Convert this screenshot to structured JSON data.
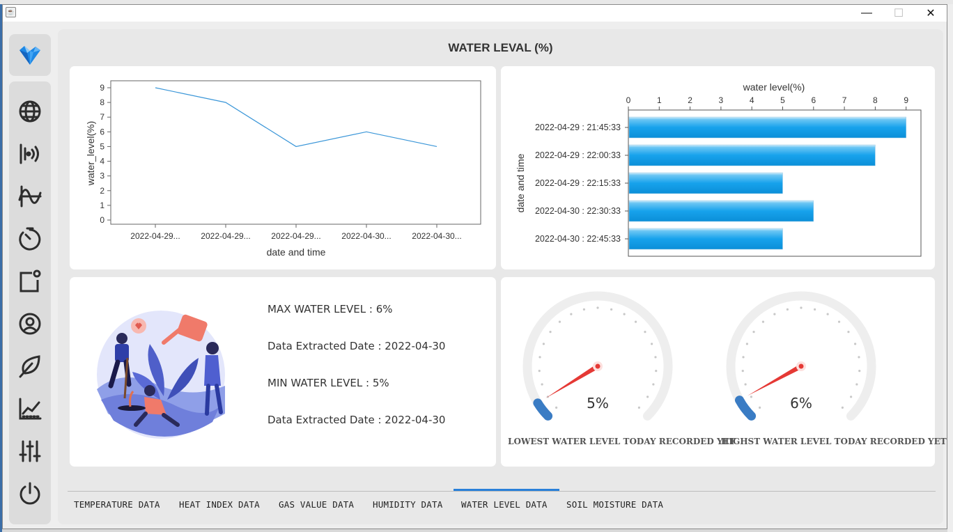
{
  "window": {
    "minimize": "—",
    "maximize": "☐",
    "close": "✕"
  },
  "page_title": "WATER LEVAL (%)",
  "sidebar": {
    "logo_icon": "iceberg-logo-icon",
    "items": [
      {
        "icon": "globe-icon"
      },
      {
        "icon": "wireless-signal-icon"
      },
      {
        "icon": "wave-graph-icon"
      },
      {
        "icon": "timer-icon"
      },
      {
        "icon": "notification-square-icon"
      },
      {
        "icon": "user-refresh-icon"
      },
      {
        "icon": "leaf-icon"
      },
      {
        "icon": "line-chart-icon"
      },
      {
        "icon": "sliders-icon"
      },
      {
        "icon": "power-icon"
      }
    ]
  },
  "line_chart_labels": {
    "ylabel": "water_level(%)",
    "xlabel": "date and time"
  },
  "bar_chart_labels": {
    "xlabel": "water level(%)",
    "ylabel": "date and time"
  },
  "chart_data": [
    {
      "type": "line",
      "title": "",
      "xlabel": "date and time",
      "ylabel": "water_level(%)",
      "x": [
        "2022-04-29...",
        "2022-04-29...",
        "2022-04-29...",
        "2022-04-30...",
        "2022-04-30..."
      ],
      "y": [
        9,
        8,
        5,
        6,
        5
      ],
      "ylim": [
        0,
        9
      ],
      "yticks": [
        0,
        1,
        2,
        3,
        4,
        5,
        6,
        7,
        8,
        9
      ],
      "color": "#3a96d8",
      "grid": false
    },
    {
      "type": "bar",
      "orientation": "horizontal",
      "title": "",
      "xlabel": "water level(%)",
      "ylabel": "date and time",
      "categories": [
        "2022-04-29 : 21:45:33",
        "2022-04-29 : 22:00:33",
        "2022-04-29 : 22:15:33",
        "2022-04-30 : 22:30:33",
        "2022-04-30 : 22:45:33"
      ],
      "values": [
        9,
        8,
        5,
        6,
        5
      ],
      "xlim": [
        0,
        9.5
      ],
      "xticks": [
        0,
        1,
        2,
        3,
        4,
        5,
        6,
        7,
        8,
        9
      ],
      "color": "#1aa7ec",
      "axis_position": "top",
      "grid": false
    }
  ],
  "info": {
    "max_label": "MAX WATER LEVEL : 6%",
    "max_date": "Data Extracted Date : 2022-04-30",
    "min_label": "MIN WATER LEVEL : 5%",
    "min_date": "Data Extracted Date : 2022-04-30"
  },
  "gauges": [
    {
      "value": 5,
      "text": "5%",
      "label": "LOWEST WATER LEVEL TODAY RECORDED YET"
    },
    {
      "value": 6,
      "text": "6%",
      "label": "HIGHST WATER LEVEL TODAY RECORDED YET"
    }
  ],
  "gauge_colors": {
    "track": "#eeeeee",
    "fill": "#3a7cc4",
    "needle": "#e53935",
    "ticks": "#c8c8c8"
  },
  "tabs": [
    {
      "label": "TEMPERATURE DATA"
    },
    {
      "label": "HEAT INDEX DATA"
    },
    {
      "label": "GAS VALUE DATA"
    },
    {
      "label": "HUMIDITY DATA"
    },
    {
      "label": "WATER LEVEL DATA",
      "active": true
    },
    {
      "label": "SOIL MOISTURE DATA"
    }
  ]
}
